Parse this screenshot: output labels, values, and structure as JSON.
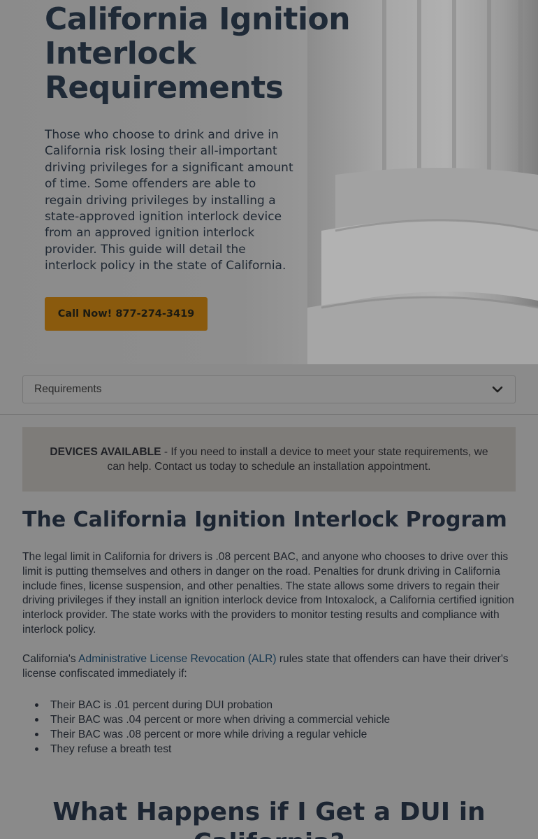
{
  "hero": {
    "title": "California Ignition Interlock Requirements",
    "description": "Those who choose to drink and drive in California risk losing their all-important driving privileges for a significant amount of time. Some offenders are able to regain driving privileges by installing a state-approved ignition interlock device from an approved ignition interlock provider. This guide will detail the interlock policy in the state of California.",
    "cta_label": "Call Now! 877-274-3419"
  },
  "nav": {
    "selected": "Requirements",
    "icon": "chevron-down-icon"
  },
  "notice": {
    "lead": "DEVICES AVAILABLE",
    "text": " - If you need to install a device to meet your state requirements, we can help. Contact us today to schedule an installation appointment."
  },
  "section1": {
    "heading": "The California Ignition Interlock Program",
    "paragraph": "The legal limit in California for drivers is .08 percent BAC, and anyone who chooses to drive over this limit is putting themselves and others in danger on the road. Penalties for drunk driving in California include fines, license suspension, and other penalties. The state allows some drivers to regain their driving privileges if they install an ignition interlock device from Intoxalock, a California certified ignition interlock provider. The state works with the providers to monitor testing results and compliance with interlock policy.",
    "alr_prefix": "California's ",
    "alr_link": "Administrative License Revocation (ALR)",
    "alr_suffix": " rules state that offenders can have their driver's license confiscated immediately if:",
    "bullets": [
      "Their BAC is .01 percent during DUI probation",
      "Their BAC was .04 percent or more when driving a commercial vehicle",
      "Their BAC was .08 percent or more while driving a regular vehicle",
      "They refuse a breath test"
    ]
  },
  "section2": {
    "heading": "What Happens if I Get a DUI in California?"
  },
  "colors": {
    "overlay_bg": "#8a8a8a",
    "cta_bg": "#8a5a0d",
    "link": "#16364f",
    "heading": "#1c2532"
  }
}
